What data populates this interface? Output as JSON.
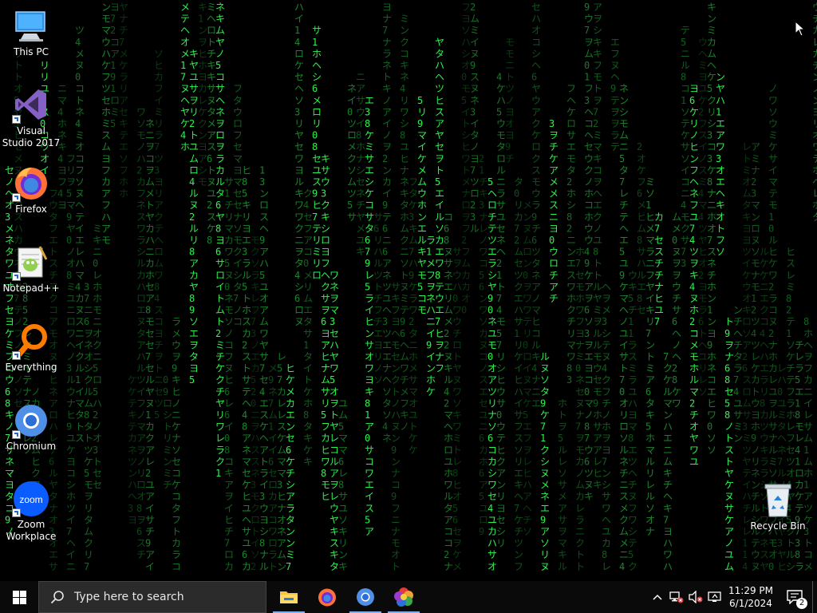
{
  "matrix_color": "#33ff55",
  "desktop_icons": [
    {
      "label": "This PC",
      "icon": "this-pc-icon",
      "shortcut": false
    },
    {
      "label": "Visual Studio 2017",
      "icon": "visual-studio-icon",
      "shortcut": true
    },
    {
      "label": "Firefox",
      "icon": "firefox-icon",
      "shortcut": true
    },
    {
      "label": "Notepad++",
      "icon": "notepad-plus-plus-icon",
      "shortcut": true
    },
    {
      "label": "Everything",
      "icon": "everything-search-icon",
      "shortcut": true
    },
    {
      "label": "Chromium",
      "icon": "chromium-icon",
      "shortcut": true
    },
    {
      "label": "Zoom Workplace",
      "icon": "zoom-icon",
      "shortcut": true
    },
    {
      "label": "Recycle Bin",
      "icon": "recycle-bin-icon",
      "shortcut": false
    }
  ],
  "taskbar": {
    "search_placeholder": "Type here to search",
    "pinned_apps": [
      "File Explorer",
      "Firefox",
      "Chromium",
      "Color app"
    ],
    "clock_time": "11:29 PM",
    "clock_date": "6/1/2024",
    "notification_count": "2"
  }
}
